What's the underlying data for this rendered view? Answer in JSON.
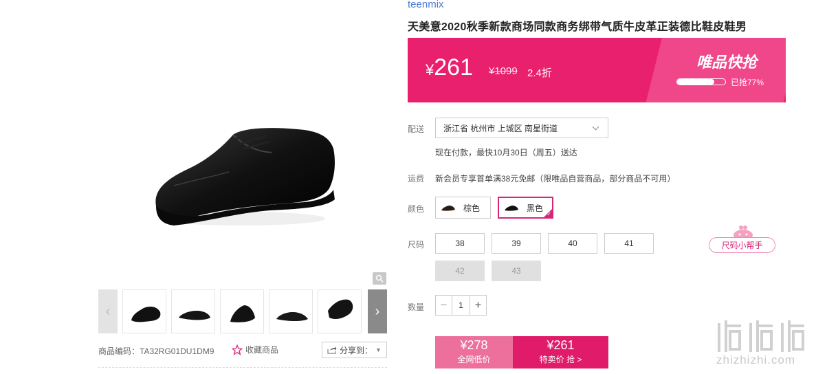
{
  "product": {
    "brand": "teenmix",
    "title": "天美意2020秋季新款商场同款商务绑带气质牛皮革正装德比鞋皮鞋男"
  },
  "gallery": {
    "thumbnails": [
      "thumb-1",
      "thumb-2",
      "thumb-3",
      "thumb-4",
      "thumb-5",
      "thumb-6"
    ],
    "prev_arrow": "‹",
    "next_arrow": "›",
    "sku_text": "商品编码：TA32RG01DU1DM9",
    "favorite_label": "收藏商品",
    "share_label": "分享到："
  },
  "price_banner": {
    "currency": "¥",
    "current_price": "261",
    "original_price": "¥1099",
    "discount": "2.4折",
    "flash_title": "唯品快抢",
    "sold_percent": 77,
    "sold_text": "已抢77%"
  },
  "delivery": {
    "label": "配送",
    "address": "浙江省 杭州市 上城区 南星街道",
    "note": "现在付款，最快10月30日（周五）送达"
  },
  "freight": {
    "label": "运费",
    "text": "新会员专享首单满38元免邮（限唯品自营商品，部分商品不可用）"
  },
  "color": {
    "label": "颜色",
    "options": [
      {
        "name": "棕色",
        "selected": false
      },
      {
        "name": "黑色",
        "selected": true
      }
    ]
  },
  "size": {
    "label": "尺码",
    "options": [
      {
        "value": "38",
        "available": true
      },
      {
        "value": "39",
        "available": true
      },
      {
        "value": "40",
        "available": true
      },
      {
        "value": "41",
        "available": true
      },
      {
        "value": "42",
        "available": false
      },
      {
        "value": "43",
        "available": false
      }
    ],
    "helper_label": "尺码小帮手"
  },
  "quantity": {
    "label": "数量",
    "minus": "−",
    "value": "1",
    "plus": "+"
  },
  "buy": {
    "left_price": "¥278",
    "left_label": "全网低价",
    "right_price": "¥261",
    "right_label": "特卖价 抢 >"
  },
  "watermark": {
    "logo_text": "值值值",
    "site": "zhizhizhi.com"
  },
  "colors": {
    "accent": "#e01b6a",
    "brand_link": "#4a7bd0",
    "disabled_bg": "#e0e0e0"
  }
}
